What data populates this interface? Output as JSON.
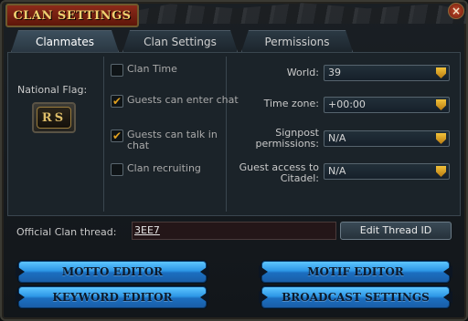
{
  "window": {
    "title": "CLAN SETTINGS",
    "close_glyph": "×"
  },
  "tabs": [
    {
      "label": "Clanmates",
      "active": true
    },
    {
      "label": "Clan Settings",
      "active": false
    },
    {
      "label": "Permissions",
      "active": false
    }
  ],
  "flag": {
    "label": "National Flag:",
    "emblem_text": "RS"
  },
  "checkboxes": [
    {
      "label": "Clan Time",
      "checked": false
    },
    {
      "label": "Guests can enter chat",
      "checked": true
    },
    {
      "label": "Guests can talk in chat",
      "checked": true
    },
    {
      "label": "Clan recruiting",
      "checked": false
    }
  ],
  "fields": [
    {
      "label": "World:",
      "value": "39"
    },
    {
      "label": "Time zone:",
      "value": "+00:00"
    },
    {
      "label": "Signpost permissions:",
      "value": "N/A"
    },
    {
      "label": "Guest access to Citadel:",
      "value": "N/A"
    }
  ],
  "thread": {
    "label": "Official Clan thread:",
    "value": "3EE7",
    "button": "Edit Thread ID"
  },
  "buttons": {
    "motto": "MOTTO EDITOR",
    "motif": "MOTIF EDITOR",
    "keyword": "KEYWORD EDITOR",
    "broadcast": "BROADCAST SETTINGS"
  },
  "colors": {
    "accent_blue": "#2d97e6",
    "title_red": "#8c2a1a",
    "check_gold": "#e0a020"
  }
}
